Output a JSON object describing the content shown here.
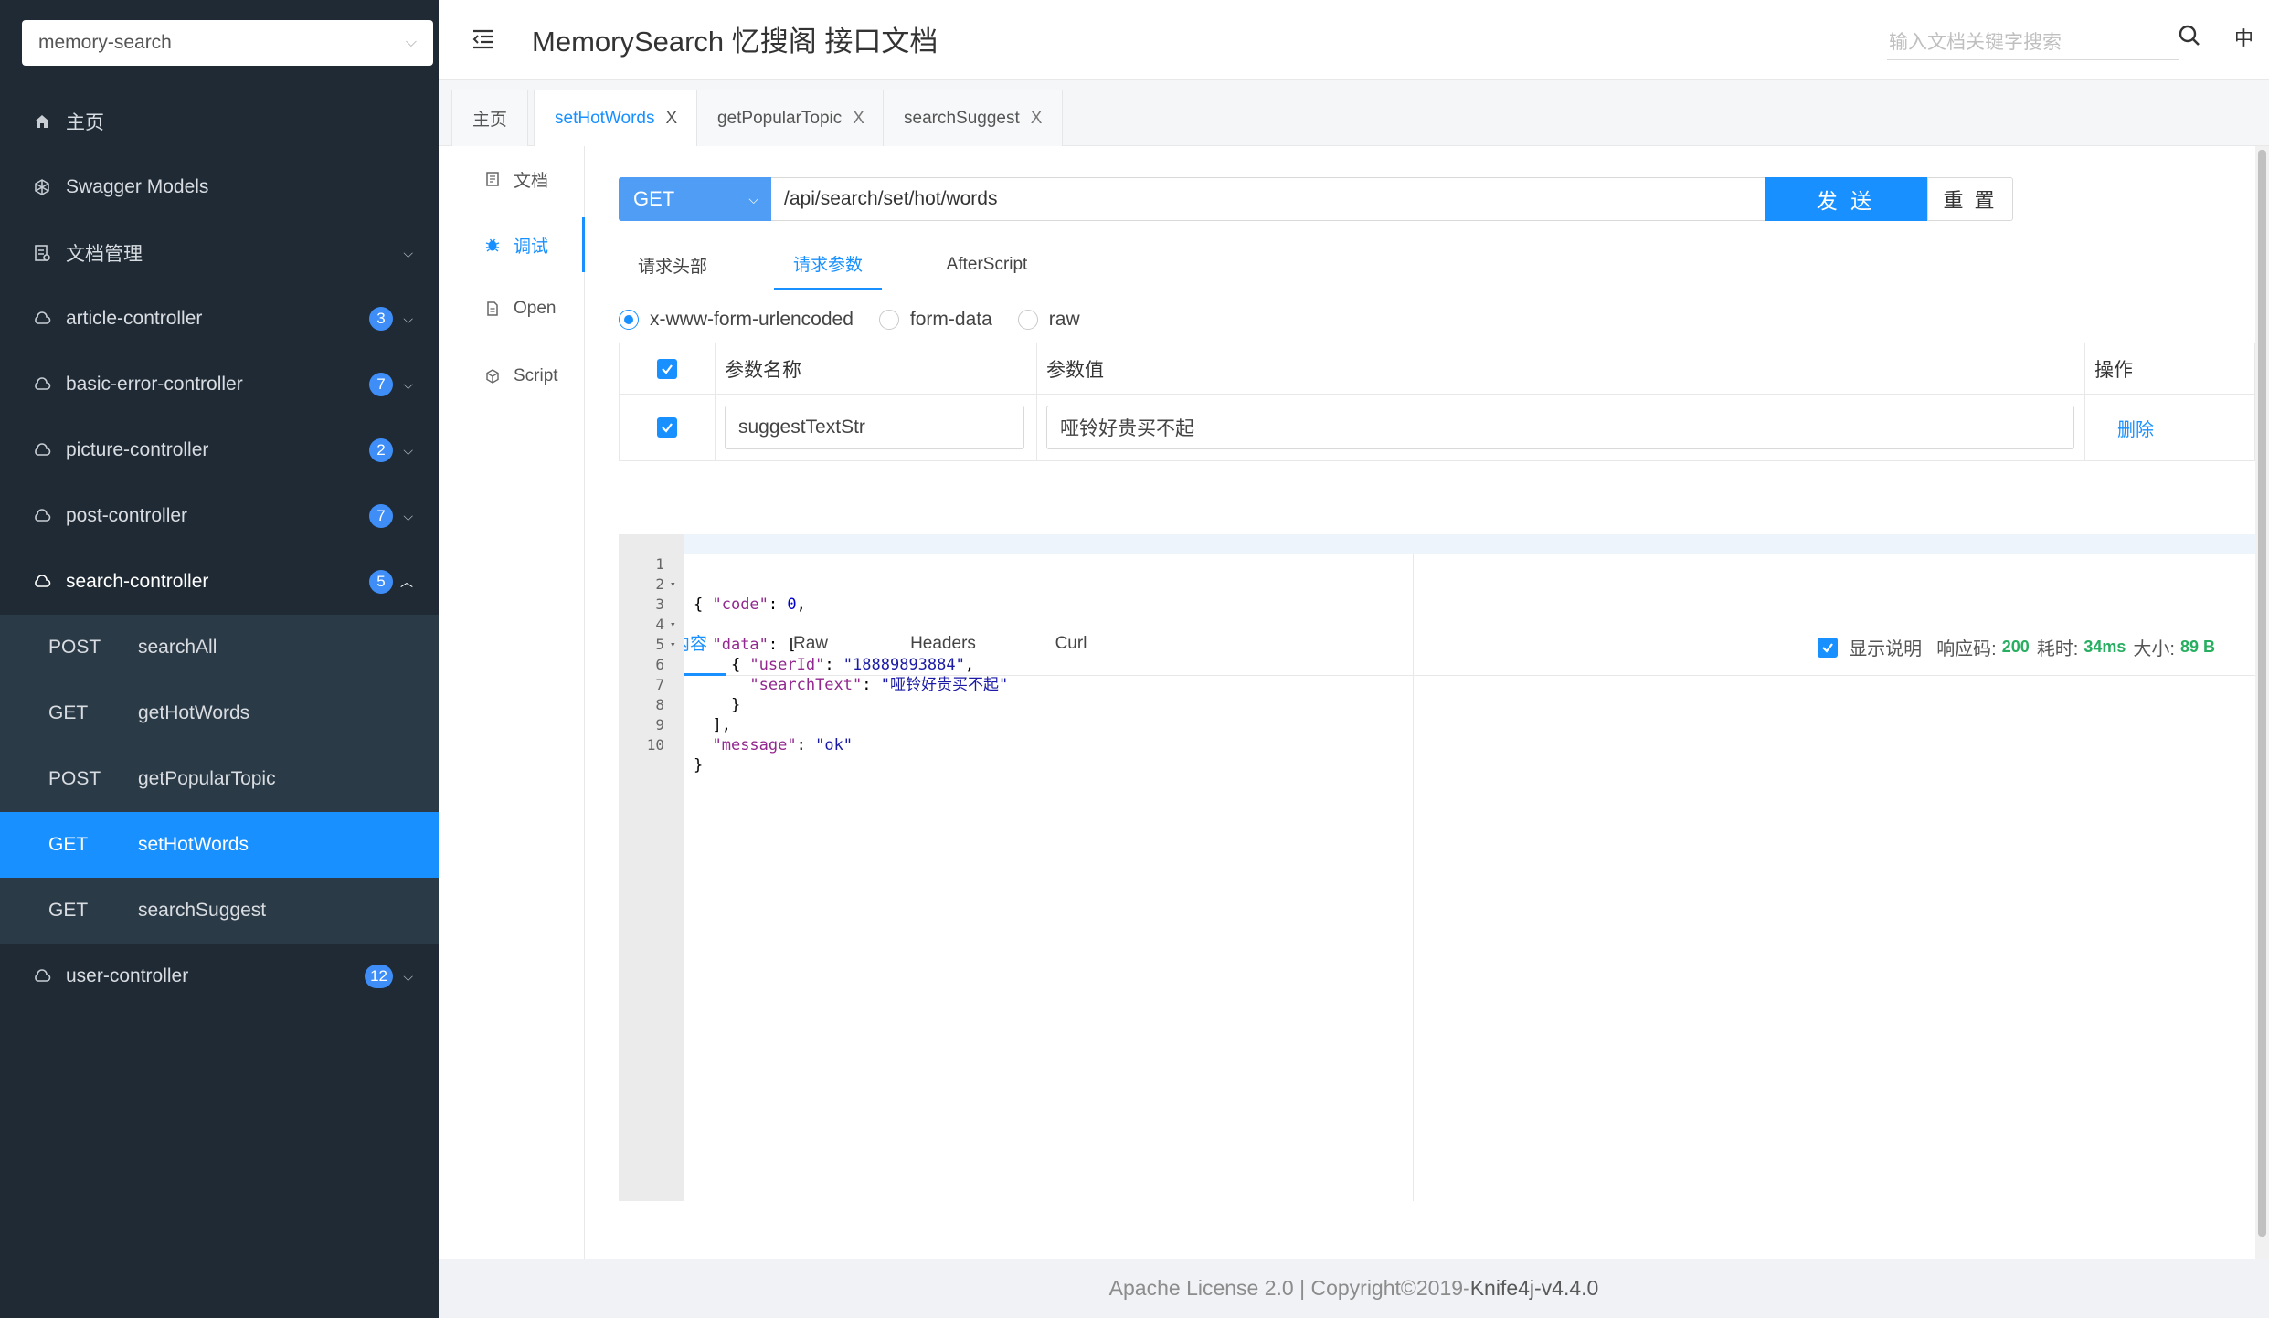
{
  "project": {
    "name": "memory-search"
  },
  "header": {
    "title": "MemorySearch 忆搜阁 接口文档",
    "search_placeholder": "输入文档关键字搜索",
    "lang": "中"
  },
  "sidebar": {
    "items": [
      {
        "label": "主页",
        "icon": "home-icon"
      },
      {
        "label": "Swagger Models",
        "icon": "cube-icon"
      },
      {
        "label": "文档管理",
        "icon": "docs-manage-icon"
      },
      {
        "label": "article-controller",
        "count": "3",
        "icon": "cloud-icon"
      },
      {
        "label": "basic-error-controller",
        "count": "7",
        "icon": "cloud-icon"
      },
      {
        "label": "picture-controller",
        "count": "2",
        "icon": "cloud-icon"
      },
      {
        "label": "post-controller",
        "count": "7",
        "icon": "cloud-icon"
      },
      {
        "label": "search-controller",
        "count": "5",
        "icon": "cloud-icon"
      },
      {
        "label": "user-controller",
        "count": "12",
        "icon": "cloud-icon"
      }
    ],
    "search_endpoints": [
      {
        "method": "POST",
        "name": "searchAll"
      },
      {
        "method": "GET",
        "name": "getHotWords"
      },
      {
        "method": "POST",
        "name": "getPopularTopic"
      },
      {
        "method": "GET",
        "name": "setHotWords"
      },
      {
        "method": "GET",
        "name": "searchSuggest"
      }
    ]
  },
  "page_tabs": [
    "主页",
    "setHotWords",
    "getPopularTopic",
    "searchSuggest"
  ],
  "page_tab_close": "X",
  "vnav": [
    "文档",
    "调试",
    "Open",
    "Script"
  ],
  "request": {
    "method": "GET",
    "url": "/api/search/set/hot/words",
    "send_label": "发 送",
    "reset_label": "重 置",
    "tabs": [
      "请求头部",
      "请求参数",
      "AfterScript"
    ],
    "content_types": [
      "x-www-form-urlencoded",
      "form-data",
      "raw"
    ],
    "table_headers": {
      "name": "参数名称",
      "value": "参数值",
      "op": "操作"
    },
    "params": [
      {
        "name": "suggestTextStr",
        "value": "哑铃好贵买不起",
        "action": "删除"
      }
    ]
  },
  "response": {
    "tabs": [
      "响应内容",
      "Raw",
      "Headers",
      "Curl"
    ],
    "show_desc_label": "显示说明",
    "code_label": "响应码:",
    "code": "200",
    "time_label": "耗时:",
    "time": "34ms",
    "size_label": "大小:",
    "size": "89 B",
    "lines": [
      {
        "n": "1",
        "fold": "▾"
      },
      {
        "n": "2"
      },
      {
        "n": "3",
        "fold": "▾"
      },
      {
        "n": "4",
        "fold": "▾"
      },
      {
        "n": "5"
      },
      {
        "n": "6"
      },
      {
        "n": "7"
      },
      {
        "n": "8"
      },
      {
        "n": "9"
      },
      {
        "n": "10"
      }
    ],
    "json": {
      "code_key": "\"code\"",
      "code_val": "0",
      "data_key": "\"data\"",
      "userId_key": "\"userId\"",
      "userId_val": "\"18889893884\"",
      "searchText_key": "\"searchText\"",
      "searchText_val": "\"哑铃好贵买不起\"",
      "message_key": "\"message\"",
      "message_val": "\"ok\""
    }
  },
  "footer": {
    "text_prefix": "Apache License 2.0 | Copyright ",
    "copyright_symbol": "©",
    "year": " 2019-",
    "brand": "Knife4j-v4.4.0"
  },
  "colors": {
    "primary": "#1890ff",
    "sidebar_bg": "#1f2a35",
    "sub_bg": "#2b3a47",
    "success": "#27ae60"
  }
}
